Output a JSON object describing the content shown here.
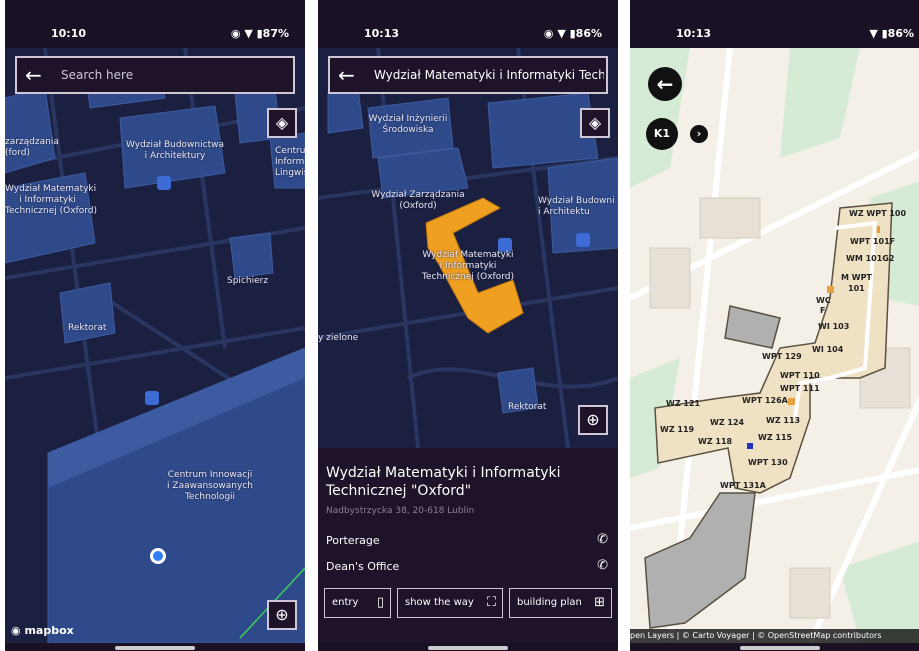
{
  "screen1": {
    "time": "10:10",
    "status_icons": "◉ ▼ ▮87%",
    "search": {
      "placeholder": "Search here"
    },
    "labels": {
      "zarzadzania_partial": "zarządzania\n(ford)",
      "matematyki": "Wydział Matematyki\ni Informatyki\nTechnicznej (Oxford)",
      "budownictwa": "Wydział Budownictwa\ni Architektury",
      "centrum_partial": "Centrum\nInform\nLingwisty",
      "spichierz": "Spichierz",
      "rektorat": "Rektorat",
      "innowacji": "Centrum Innowacji\ni Zaawansowanych\nTechnologii"
    },
    "mapbox_logo": "mapbox"
  },
  "screen2": {
    "time": "10:13",
    "status_icons": "◉ ▼ ▮86%",
    "search": {
      "value": "Wydział Matematyki i Informatyki Techn"
    },
    "labels": {
      "inzynierii": "Wydział Inżynierii\nŚrodowiska",
      "zarzadzania": "Wydział Zarządzania\n(Oxford)",
      "matematyki": "Wydział Matematyki\ni Informatyki\nTechnicznej (Oxford)",
      "budownictwa": "Wydział Budowni\ni Architektu",
      "zielone": "y zielone",
      "rektorat": "Rektorat"
    },
    "panel": {
      "title": "Wydział Matematyki i Informatyki Technicznej \"Oxford\"",
      "address": "Nadbystrzycka 38, 20-618 Lublin",
      "porterage": "Porterage",
      "deans_office": "Dean's Office",
      "entry": "entry",
      "show_the_way": "show the way",
      "building_plan": "building plan"
    }
  },
  "screen3": {
    "time": "10:13",
    "status_icons": "▼ ▮86%",
    "floor": "K1",
    "rooms": {
      "r1": "WZ WPT 100",
      "r2": "WPT 101F",
      "r3": "WM 101G2",
      "r4": "M WPT",
      "r5": "101",
      "r6": "WC",
      "r7": "F",
      "r8": "WI 103",
      "r9": "WI 104",
      "r10": "WPT 129",
      "r11": "WPT 110",
      "r12": "WPT 111",
      "r13": "WPT 126A",
      "r14": "WZ 121",
      "r15": "WZ 124",
      "r16": "WZ 113",
      "r17": "WZ 119",
      "r18": "WZ 118",
      "r19": "WZ 115",
      "r20": "WPT 130",
      "r21": "WPT 131A"
    },
    "attribution": "pen Layers | © Carto Voyager | © OpenStreetMap contributors"
  },
  "colors": {
    "status_bar": "#1a1124",
    "dark_map": "#1b2040",
    "building": "#2f4a8a",
    "highlight": "#f0a020",
    "light_map": "#f4f0e8"
  }
}
